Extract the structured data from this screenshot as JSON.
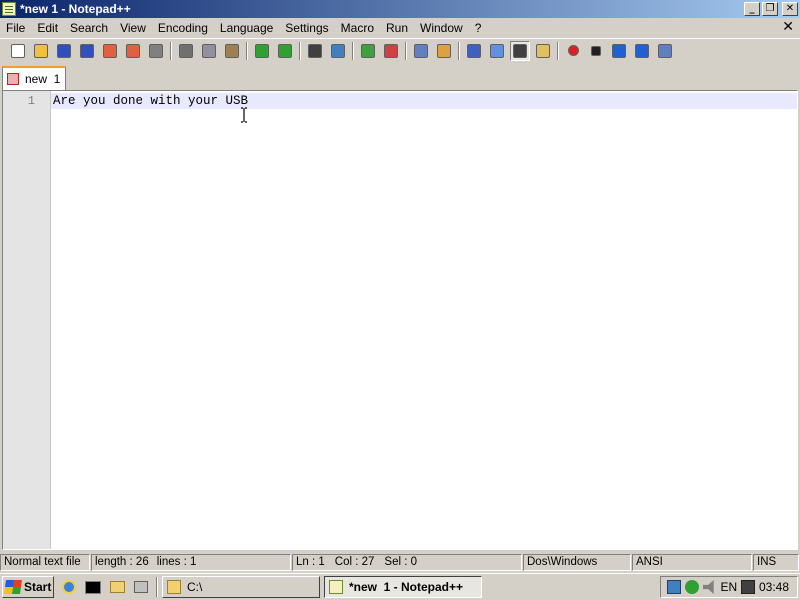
{
  "window": {
    "title": "*new  1 - Notepad++",
    "buttons": {
      "minimize": "_",
      "restore": "❐",
      "close": "✕"
    }
  },
  "menubar": {
    "items": [
      "File",
      "Edit",
      "Search",
      "View",
      "Encoding",
      "Language",
      "Settings",
      "Macro",
      "Run",
      "Window",
      "?"
    ],
    "doc_close": "✕"
  },
  "toolbar": {
    "groups": [
      [
        "new-file-icon",
        "open-file-icon",
        "save-icon",
        "save-all-icon",
        "close-icon",
        "close-all-icon",
        "print-icon"
      ],
      [
        "cut-icon",
        "copy-icon",
        "paste-icon"
      ],
      [
        "undo-icon",
        "redo-icon"
      ],
      [
        "find-icon",
        "replace-icon"
      ],
      [
        "zoom-in-icon",
        "zoom-out-icon"
      ],
      [
        "sync-vertical-icon",
        "sync-horizontal-icon"
      ],
      [
        "word-wrap-icon",
        "show-all-characters-icon",
        "indent-guide-icon",
        "user-defined-language-icon"
      ],
      [
        "record-macro-icon",
        "stop-recording-icon",
        "play-macro-icon",
        "run-macro-multiple-icon",
        "save-macro-icon"
      ]
    ],
    "colors": {
      "new-file-icon": "#ffffff",
      "open-file-icon": "#f0c040",
      "save-icon": "#3050c0",
      "save-all-icon": "#3050c0",
      "close-icon": "#e06040",
      "close-all-icon": "#e06040",
      "print-icon": "#808080",
      "cut-icon": "#707070",
      "copy-icon": "#9090a0",
      "paste-icon": "#a08050",
      "undo-icon": "#30a030",
      "redo-icon": "#30a030",
      "find-icon": "#404040",
      "replace-icon": "#4080c0",
      "zoom-in-icon": "#40a040",
      "zoom-out-icon": "#d04040",
      "sync-vertical-icon": "#6080c0",
      "sync-horizontal-icon": "#e0a040",
      "word-wrap-icon": "#4060c0",
      "show-all-characters-icon": "#6090e0",
      "indent-guide-icon": "#404040",
      "user-defined-language-icon": "#e0c060",
      "record-macro-icon": "#e02020",
      "stop-recording-icon": "#202020",
      "play-macro-icon": "#2060d0",
      "run-macro-multiple-icon": "#2060d0",
      "save-macro-icon": "#6080c0"
    },
    "pressed": [
      "indent-guide-icon"
    ]
  },
  "tab": {
    "label": "new  1",
    "accent": "#f0a030"
  },
  "editor": {
    "line_number": "1",
    "line_text": "Are you done with your USB"
  },
  "statusbar": {
    "type": "Normal text file",
    "length": "length : 26",
    "lines": "lines : 1",
    "ln": "Ln : 1",
    "col": "Col : 27",
    "sel": "Sel : 0",
    "eol": "Dos\\Windows",
    "encoding": "ANSI",
    "mode": "INS"
  },
  "taskbar": {
    "start_label": "Start",
    "quicklaunch": [
      "ie-icon",
      "cmd-icon",
      "explorer-icon",
      "desktop-icon"
    ],
    "tasks": [
      {
        "label": "C:\\",
        "active": false
      },
      {
        "label": "*new  1 - Notepad++",
        "active": true
      }
    ],
    "tray": {
      "lang": "EN",
      "time": "03:48"
    }
  }
}
